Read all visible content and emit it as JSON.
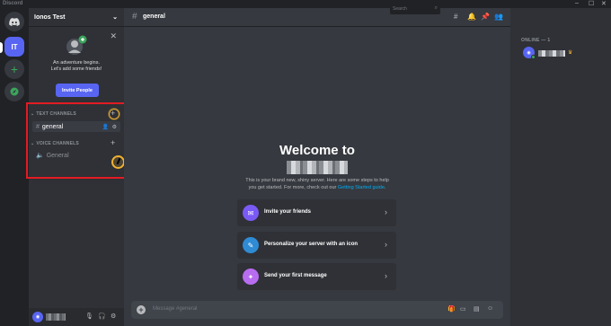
{
  "window": {
    "app_name": "Discord",
    "minimize": "–",
    "maximize": "☐",
    "close": "✕"
  },
  "guilds": {
    "home_label": "discord-home",
    "server_initials": "IT",
    "add_label": "+",
    "explore_label": "compass"
  },
  "sidebar": {
    "server_name": "Ionos Test",
    "chevron": "⌄",
    "invite": {
      "close": "✕",
      "line1": "An adventure begins.",
      "line2": "Let's add some friends!",
      "button": "Invite People"
    },
    "text_category": "TEXT CHANNELS",
    "voice_category": "VOICE CHANNELS",
    "text_channels": [
      {
        "name": "general"
      }
    ],
    "voice_channels": [
      {
        "name": "General"
      }
    ]
  },
  "main": {
    "channel_name": "general",
    "search_placeholder": "Search",
    "welcome_title": "Welcome to",
    "welcome_sub_line1": "This is your brand new, shiny server. Here are some steps to help",
    "welcome_sub_line2_prefix": "you get started. For more, check out our ",
    "welcome_sub_link": "Getting Started guide",
    "welcome_sub_line2_suffix": ".",
    "actions": [
      {
        "label": "Invite your friends",
        "color": "#7a5af5"
      },
      {
        "label": "Personalize your server with an icon",
        "color": "#2f8bd4"
      },
      {
        "label": "Send your first message",
        "color": "#b86cf0"
      }
    ],
    "composer_placeholder": "Message #general"
  },
  "members": {
    "heading": "ONLINE — 1"
  },
  "colors": {
    "accent": "#5865f2",
    "online": "#3ba55c",
    "highlight": "#e31b23",
    "link": "#00aff4"
  }
}
